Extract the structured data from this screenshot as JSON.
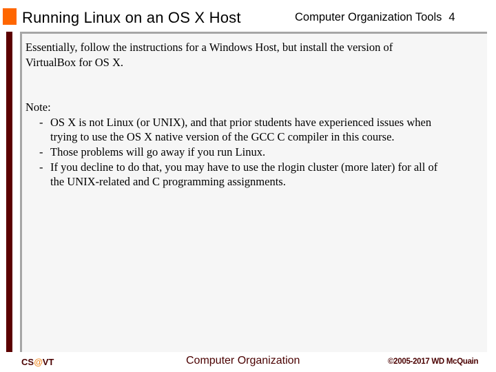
{
  "header": {
    "title": "Running Linux on an OS X Host",
    "course": "Computer Organization Tools",
    "page_number": "4",
    "accent_color": "#ff6600",
    "bar_color": "#5c0000"
  },
  "body": {
    "intro_line1": "Essentially, follow the instructions for a Windows Host, but install the version of",
    "intro_line2": "VirtualBox for OS X.",
    "note_label": "Note:",
    "bullet_marker": "-",
    "bullets": [
      {
        "line1": "OS X is not Linux (or UNIX), and that prior students have experienced issues when",
        "line2": "trying to use the OS X native version of the GCC C compiler in this course."
      },
      {
        "line1": "Those problems will go away if you run Linux."
      },
      {
        "line1": "If you decline to do that, you may have to use the rlogin cluster (more later) for all of",
        "line2": "the UNIX-related and C programming assignments."
      }
    ]
  },
  "footer": {
    "left_prefix": "CS",
    "left_at": "@",
    "left_suffix": "VT",
    "center": "Computer Organization",
    "right": "©2005-2017 WD McQuain"
  }
}
